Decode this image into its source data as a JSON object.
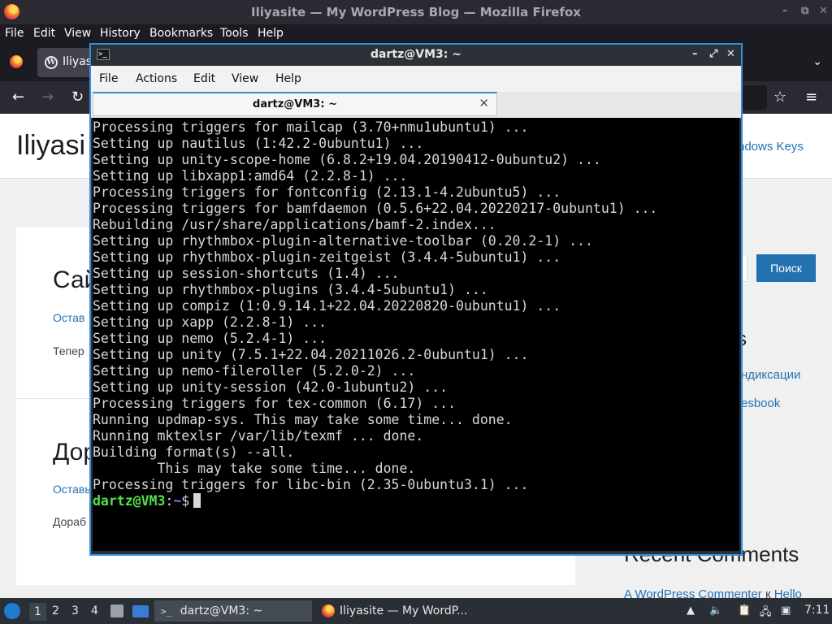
{
  "firefox": {
    "window_title": "Iliyasite — My WordPress Blog — Mozilla Firefox",
    "menu": [
      "File",
      "Edit",
      "View",
      "History",
      "Bookmarks",
      "Tools",
      "Help"
    ],
    "tab_label": "Iliyas"
  },
  "website": {
    "site_title": "Iliyasi",
    "menu_item": "ndows Keys",
    "post1_title": "Сай",
    "post1_link": "Остав",
    "post1_text": "Тепер",
    "post2_title": "Дор",
    "post2_link": "Оставь",
    "post2_text": "Дораб",
    "search_button": "Поиск",
    "sidebar_heading": "s",
    "sidebar_link1": "ндиксации",
    "sidebar_link2": "esbook",
    "recent_comments_heading": "Recent Comments",
    "comment_author": "A WordPress Commenter",
    "comment_on": "к",
    "comment_post": "Hello"
  },
  "terminal": {
    "window_title": "dartz@VM3: ~",
    "menu": [
      "File",
      "Actions",
      "Edit",
      "View",
      "Help"
    ],
    "tab_label": "dartz@VM3: ~",
    "output_lines": [
      "Processing triggers for mailcap (3.70+nmu1ubuntu1) ...",
      "Setting up nautilus (1:42.2-0ubuntu1) ...",
      "Setting up unity-scope-home (6.8.2+19.04.20190412-0ubuntu2) ...",
      "Setting up libxapp1:amd64 (2.2.8-1) ...",
      "Processing triggers for fontconfig (2.13.1-4.2ubuntu5) ...",
      "Processing triggers for bamfdaemon (0.5.6+22.04.20220217-0ubuntu1) ...",
      "Rebuilding /usr/share/applications/bamf-2.index...",
      "Setting up rhythmbox-plugin-alternative-toolbar (0.20.2-1) ...",
      "Setting up rhythmbox-plugin-zeitgeist (3.4.4-5ubuntu1) ...",
      "Setting up session-shortcuts (1.4) ...",
      "Setting up rhythmbox-plugins (3.4.4-5ubuntu1) ...",
      "Setting up compiz (1:0.9.14.1+22.04.20220820-0ubuntu1) ...",
      "Setting up xapp (2.2.8-1) ...",
      "Setting up nemo (5.2.4-1) ...",
      "Setting up unity (7.5.1+22.04.20211026.2-0ubuntu1) ...",
      "Setting up nemo-fileroller (5.2.0-2) ...",
      "Setting up unity-session (42.0-1ubuntu2) ...",
      "Processing triggers for tex-common (6.17) ...",
      "Running updmap-sys. This may take some time... done.",
      "Running mktexlsr /var/lib/texmf ... done.",
      "Building format(s) --all.",
      "        This may take some time... done.",
      "Processing triggers for libc-bin (2.35-0ubuntu3.1) ..."
    ],
    "prompt_user": "dartz@VM3",
    "prompt_sep": ":",
    "prompt_dir": "~",
    "prompt_symbol": "$"
  },
  "taskbar": {
    "workspaces": [
      "1",
      "2",
      "3",
      "4"
    ],
    "terminal_task": "dartz@VM3: ~",
    "firefox_task": "Iliyasite — My WordP...",
    "clock": "7:11"
  }
}
